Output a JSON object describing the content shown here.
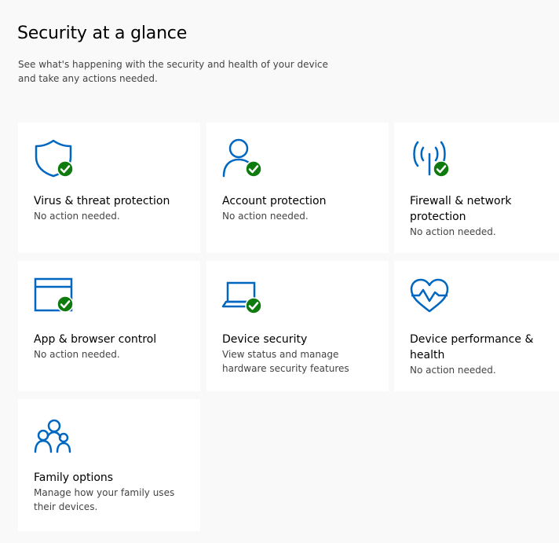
{
  "header": {
    "title": "Security at a glance",
    "subtitle": "See what's happening with the security and health of your device and take any actions needed."
  },
  "colors": {
    "accent": "#0067c0",
    "ok": "#0f7b0f",
    "tile_bg": "#ffffff",
    "page_bg": "#f9f9f9"
  },
  "tiles": [
    {
      "title": "Virus & threat protection",
      "status": "No action needed.",
      "icon": "shield-icon",
      "badge": "check-badge-icon"
    },
    {
      "title": "Account protection",
      "status": "No action needed.",
      "icon": "person-icon",
      "badge": "check-badge-icon"
    },
    {
      "title": "Firewall & network protection",
      "status": "No action needed.",
      "icon": "antenna-icon",
      "badge": "check-badge-icon"
    },
    {
      "title": "App & browser control",
      "status": "No action needed.",
      "icon": "app-window-icon",
      "badge": "check-badge-icon"
    },
    {
      "title": "Device security",
      "status": "View status and manage hardware security features",
      "icon": "laptop-icon",
      "badge": "check-badge-icon"
    },
    {
      "title": "Device performance & health",
      "status": "No action needed.",
      "icon": "heart-pulse-icon"
    },
    {
      "title": "Family options",
      "status": "Manage how your family uses their devices.",
      "icon": "family-icon"
    }
  ]
}
